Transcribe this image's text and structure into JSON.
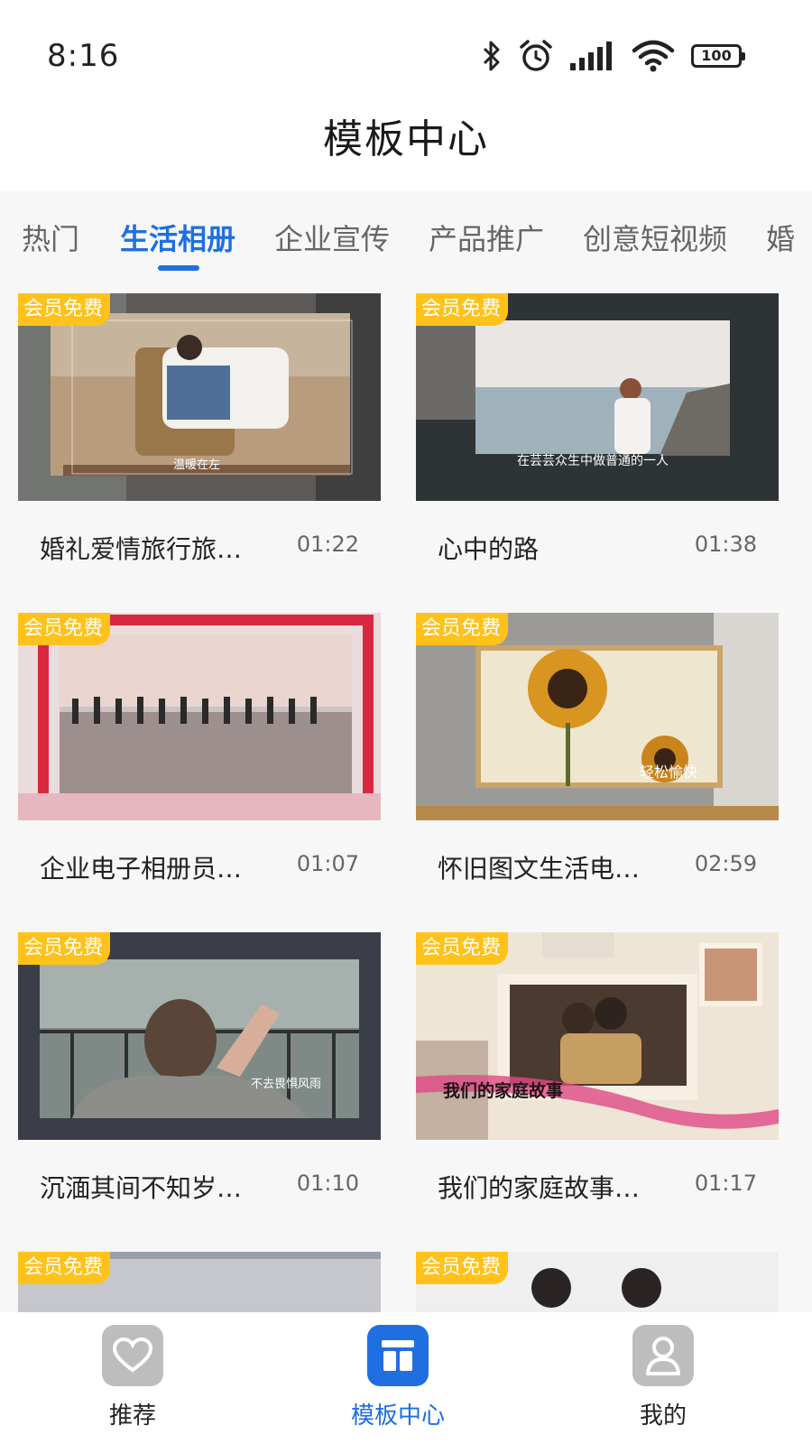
{
  "status": {
    "time": "8:16",
    "battery": "100"
  },
  "header": {
    "title": "模板中心"
  },
  "tabs": [
    {
      "label": "热门"
    },
    {
      "label": "生活相册",
      "active": true
    },
    {
      "label": "企业宣传"
    },
    {
      "label": "产品推广"
    },
    {
      "label": "创意短视频"
    },
    {
      "label": "婚"
    }
  ],
  "badge_text": "会员免费",
  "cards": [
    {
      "title": "婚礼爱情旅行旅…",
      "duration": "01:22",
      "overlay_text": "温暖在左"
    },
    {
      "title": "心中的路",
      "duration": "01:38",
      "overlay_text": "在芸芸众生中做普通的一人"
    },
    {
      "title": "企业电子相册员…",
      "duration": "01:07"
    },
    {
      "title": "怀旧图文生活电…",
      "duration": "02:59",
      "overlay_text": "轻松愉快"
    },
    {
      "title": "沉湎其间不知岁…",
      "duration": "01:10",
      "overlay_text": "不去畏惧风雨"
    },
    {
      "title": "我们的家庭故事…",
      "duration": "01:17",
      "overlay_text": "我们的家庭故事"
    }
  ],
  "nav": [
    {
      "label": "推荐",
      "icon": "heart-icon",
      "color": "#b8b8b8"
    },
    {
      "label": "模板中心",
      "icon": "template-icon",
      "color": "#1f6fe0",
      "active": true
    },
    {
      "label": "我的",
      "icon": "user-icon",
      "color": "#b8b8b8"
    }
  ],
  "colors": {
    "accent": "#1f6fe0",
    "badge": "#ffc21a"
  }
}
